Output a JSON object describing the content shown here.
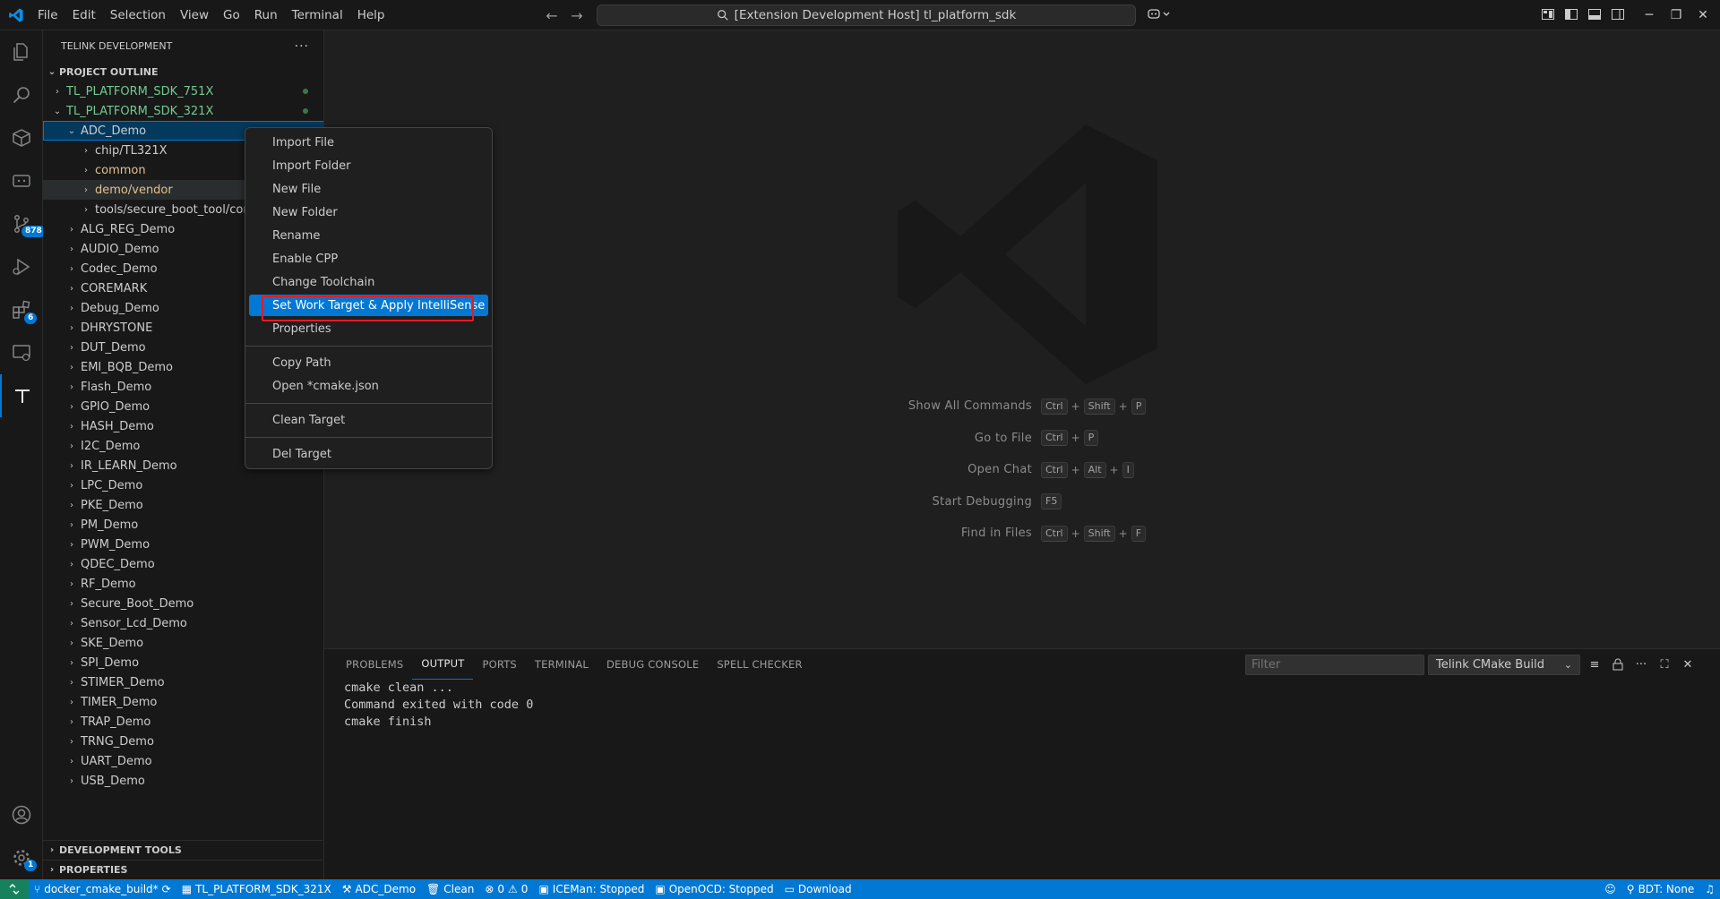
{
  "titlebar": {
    "menus": [
      "File",
      "Edit",
      "Selection",
      "View",
      "Go",
      "Run",
      "Terminal",
      "Help"
    ],
    "command_center": "[Extension Development Host] tl_platform_sdk"
  },
  "activity_bar": {
    "scm_badge": "878",
    "extensions_badge": "6",
    "settings_badge": "1"
  },
  "sidebar": {
    "title": "TELINK DEVELOPMENT",
    "outline_header": "PROJECT OUTLINE",
    "tree": [
      {
        "label": "TL_PLATFORM_SDK_751X",
        "level": 0,
        "expanded": false,
        "color": "green",
        "dot": true
      },
      {
        "label": "TL_PLATFORM_SDK_321X",
        "level": 0,
        "expanded": true,
        "color": "green",
        "dot": true
      },
      {
        "label": "ADC_Demo",
        "level": 1,
        "expanded": true,
        "selected": true
      },
      {
        "label": "chip/TL321X",
        "level": 2,
        "expanded": false
      },
      {
        "label": "common",
        "level": 2,
        "expanded": false,
        "color": "yellow"
      },
      {
        "label": "demo/vendor",
        "level": 2,
        "expanded": false,
        "color": "yellow",
        "hover": true
      },
      {
        "label": "tools/secure_boot_tool/config",
        "level": 2,
        "expanded": false
      },
      {
        "label": "ALG_REG_Demo",
        "level": 1,
        "expanded": false
      },
      {
        "label": "AUDIO_Demo",
        "level": 1,
        "expanded": false
      },
      {
        "label": "Codec_Demo",
        "level": 1,
        "expanded": false
      },
      {
        "label": "COREMARK",
        "level": 1,
        "expanded": false
      },
      {
        "label": "Debug_Demo",
        "level": 1,
        "expanded": false
      },
      {
        "label": "DHRYSTONE",
        "level": 1,
        "expanded": false
      },
      {
        "label": "DUT_Demo",
        "level": 1,
        "expanded": false
      },
      {
        "label": "EMI_BQB_Demo",
        "level": 1,
        "expanded": false
      },
      {
        "label": "Flash_Demo",
        "level": 1,
        "expanded": false
      },
      {
        "label": "GPIO_Demo",
        "level": 1,
        "expanded": false
      },
      {
        "label": "HASH_Demo",
        "level": 1,
        "expanded": false
      },
      {
        "label": "I2C_Demo",
        "level": 1,
        "expanded": false
      },
      {
        "label": "IR_LEARN_Demo",
        "level": 1,
        "expanded": false
      },
      {
        "label": "LPC_Demo",
        "level": 1,
        "expanded": false
      },
      {
        "label": "PKE_Demo",
        "level": 1,
        "expanded": false
      },
      {
        "label": "PM_Demo",
        "level": 1,
        "expanded": false
      },
      {
        "label": "PWM_Demo",
        "level": 1,
        "expanded": false
      },
      {
        "label": "QDEC_Demo",
        "level": 1,
        "expanded": false
      },
      {
        "label": "RF_Demo",
        "level": 1,
        "expanded": false
      },
      {
        "label": "Secure_Boot_Demo",
        "level": 1,
        "expanded": false
      },
      {
        "label": "Sensor_Lcd_Demo",
        "level": 1,
        "expanded": false
      },
      {
        "label": "SKE_Demo",
        "level": 1,
        "expanded": false
      },
      {
        "label": "SPI_Demo",
        "level": 1,
        "expanded": false
      },
      {
        "label": "STIMER_Demo",
        "level": 1,
        "expanded": false
      },
      {
        "label": "TIMER_Demo",
        "level": 1,
        "expanded": false
      },
      {
        "label": "TRAP_Demo",
        "level": 1,
        "expanded": false
      },
      {
        "label": "TRNG_Demo",
        "level": 1,
        "expanded": false
      },
      {
        "label": "UART_Demo",
        "level": 1,
        "expanded": false
      },
      {
        "label": "USB_Demo",
        "level": 1,
        "expanded": false
      }
    ],
    "dev_tools_header": "DEVELOPMENT TOOLS",
    "properties_header": "PROPERTIES"
  },
  "context_menu": {
    "groups": [
      [
        "Import File",
        "Import Folder",
        "New File",
        "New Folder",
        "Rename",
        "Enable CPP",
        "Change Toolchain",
        "Set Work Target & Apply IntelliSense",
        "Properties"
      ],
      [
        "Copy Path",
        "Open *cmake.json"
      ],
      [
        "Clean Target"
      ],
      [
        "Del Target"
      ]
    ],
    "highlighted": "Set Work Target & Apply IntelliSense"
  },
  "editor": {
    "shortcuts": [
      {
        "label": "Show All Commands",
        "keys": [
          "Ctrl",
          "Shift",
          "P"
        ]
      },
      {
        "label": "Go to File",
        "keys": [
          "Ctrl",
          "P"
        ]
      },
      {
        "label": "Open Chat",
        "keys": [
          "Ctrl",
          "Alt",
          "I"
        ]
      },
      {
        "label": "Start Debugging",
        "keys": [
          "F5"
        ]
      },
      {
        "label": "Find in Files",
        "keys": [
          "Ctrl",
          "Shift",
          "F"
        ]
      }
    ]
  },
  "panel": {
    "tabs": [
      "PROBLEMS",
      "OUTPUT",
      "PORTS",
      "TERMINAL",
      "DEBUG CONSOLE",
      "SPELL CHECKER"
    ],
    "active_tab": "OUTPUT",
    "filter_placeholder": "Filter",
    "channel": "Telink CMake Build",
    "output_lines": [
      "cmake clean ...",
      "Command exited with code 0",
      "cmake finish"
    ]
  },
  "statusbar": {
    "branch": "docker_cmake_build*",
    "sdk": "TL_PLATFORM_SDK_321X",
    "target": "ADC_Demo",
    "clean": "Clean",
    "errors": "0",
    "warnings": "0",
    "iceman": "ICEMan: Stopped",
    "openocd": "OpenOCD: Stopped",
    "download": "Download",
    "bdt": "BDT: None"
  },
  "colors": {
    "accent": "#0078d4",
    "folder_green": "#73c991",
    "folder_yellow": "#e2c08d",
    "annotation_red": "#e51b2a"
  }
}
